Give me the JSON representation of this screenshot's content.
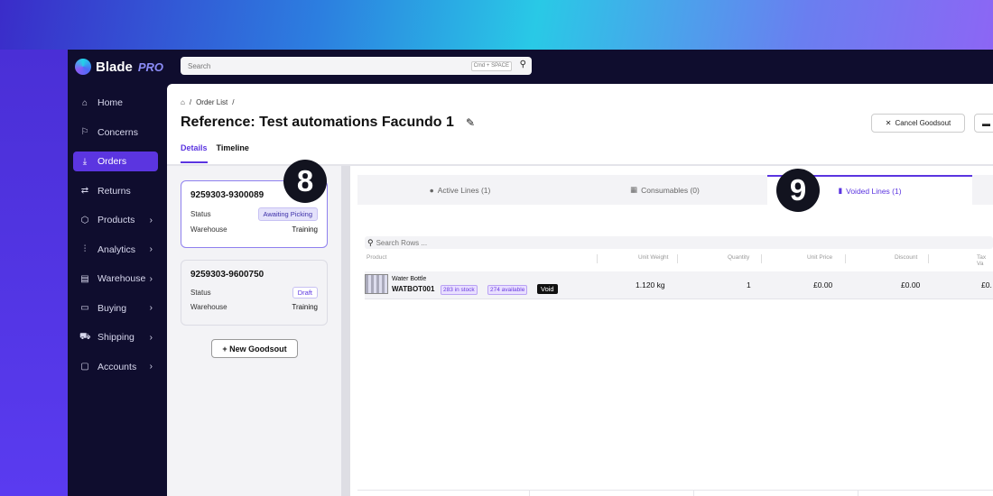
{
  "app": {
    "logo_text": "Blade",
    "logo_suffix": "PRO"
  },
  "search": {
    "placeholder": "Search",
    "shortcut": "Cmd + SPACE"
  },
  "sidebar": {
    "items": [
      {
        "label": "Home",
        "icon": "home-icon",
        "glyph": "⌂",
        "chevron": false,
        "active": false
      },
      {
        "label": "Concerns",
        "icon": "flag-icon",
        "glyph": "⚐",
        "chevron": false,
        "active": false
      },
      {
        "label": "Orders",
        "icon": "inbox-icon",
        "glyph": "⤓",
        "chevron": false,
        "active": true
      },
      {
        "label": "Returns",
        "icon": "exchange-icon",
        "glyph": "⇄",
        "chevron": false,
        "active": false
      },
      {
        "label": "Products",
        "icon": "cube-icon",
        "glyph": "⬡",
        "chevron": true,
        "active": false
      },
      {
        "label": "Analytics",
        "icon": "chart-icon",
        "glyph": "⫶",
        "chevron": true,
        "active": false
      },
      {
        "label": "Warehouse",
        "icon": "warehouse-icon",
        "glyph": "▤",
        "chevron": true,
        "active": false
      },
      {
        "label": "Buying",
        "icon": "card-icon",
        "glyph": "▭",
        "chevron": true,
        "active": false
      },
      {
        "label": "Shipping",
        "icon": "truck-icon",
        "glyph": "⛟",
        "chevron": true,
        "active": false
      },
      {
        "label": "Accounts",
        "icon": "book-icon",
        "glyph": "▢",
        "chevron": true,
        "active": false
      }
    ]
  },
  "breadcrumb": {
    "sep1": "/",
    "order_list": "Order List",
    "sep2": "/"
  },
  "header": {
    "title": "Reference: Test automations Facundo 1",
    "cancel_label": "Cancel Goodsout",
    "tabs": [
      "Details",
      "Timeline"
    ]
  },
  "goodsouts": [
    {
      "id": "9259303-9300089",
      "status_label": "Status",
      "status": "Awaiting Picking",
      "warehouse_label": "Warehouse",
      "warehouse": "Training"
    },
    {
      "id": "9259303-9600750",
      "status_label": "Status",
      "status": "Draft",
      "warehouse_label": "Warehouse",
      "warehouse": "Training"
    }
  ],
  "new_goodsout_label": "+ New Goodsout",
  "lines_tabs": [
    {
      "label": "Active Lines (1)",
      "active": false
    },
    {
      "label": "Consumables (0)",
      "active": false
    },
    {
      "label": "Voided Lines (1)",
      "active": true
    }
  ],
  "rows_search_placeholder": "Search Rows ...",
  "table": {
    "columns": [
      "Product",
      "Unit Weight",
      "Quantity",
      "Unit Price",
      "Discount",
      "Tax Va"
    ],
    "row": {
      "name": "Water Bottle",
      "sku": "WATBOT001",
      "in_stock": "283 in stock",
      "available": "274 available",
      "status": "Void",
      "unit_weight": "1.120 kg",
      "quantity": "1",
      "unit_price": "£0.00",
      "discount": "£0.00",
      "tax": "£0."
    }
  },
  "steps": [
    "8",
    "9"
  ],
  "colors": {
    "accent": "#5b35e0",
    "sidebar_bg": "#0f0d2e",
    "step_marker": "#12131f"
  }
}
